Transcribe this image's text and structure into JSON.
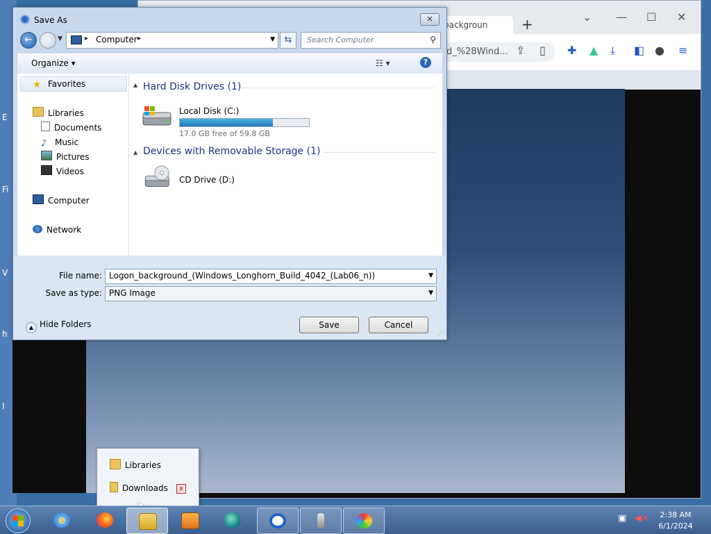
{
  "desktop": {
    "letters": [
      "E",
      "Fi",
      "V",
      "h",
      "I"
    ]
  },
  "browser": {
    "tab_label": "background_",
    "new_tab": "+",
    "window_controls": {
      "minimize": "—",
      "maximize": "☐",
      "close": "✕",
      "dropdown": "⌄"
    },
    "url_text": "d_%28Wind...",
    "toolbar_icons": [
      "share-icon",
      "bookmark-icon",
      "extensions-icon",
      "lab-icon",
      "download-icon",
      "sidebar-icon",
      "profile-icon",
      "menu-icon"
    ]
  },
  "dialog": {
    "title": "Save As",
    "address": {
      "location": "Computer"
    },
    "search_placeholder": "Search Computer",
    "organize_label": "Organize ▾",
    "nav_pane": {
      "favorites": "Favorites",
      "libraries": "Libraries",
      "library_items": [
        "Documents",
        "Music",
        "Pictures",
        "Videos"
      ],
      "computer": "Computer",
      "network": "Network"
    },
    "groups": {
      "hard_disks": "Hard Disk Drives (1)",
      "removable": "Devices with Removable Storage (1)"
    },
    "drives": {
      "local": {
        "name": "Local Disk (C:)",
        "free": "17.0 GB free of 59.8 GB",
        "used_fraction": 0.72
      },
      "cd": {
        "name": "CD Drive (D:)"
      }
    },
    "file_name_label": "File name:",
    "file_name_value": "Logon_background_(Windows_Longhorn_Build_4042_(Lab06_n))",
    "type_label": "Save as type:",
    "type_value": "PNG Image",
    "hide_folders": "Hide Folders",
    "save_button": "Save",
    "cancel_button": "Cancel"
  },
  "jumplist": {
    "items": [
      "Libraries",
      "Downloads"
    ],
    "close": "x"
  },
  "taskbar": {
    "apps": [
      "internet-explorer",
      "firefox",
      "windows-explorer",
      "media-player",
      "edge",
      "chrome",
      "usb-tool",
      "paint"
    ],
    "clock_time": "2:38 AM",
    "clock_date": "6/1/2024"
  }
}
